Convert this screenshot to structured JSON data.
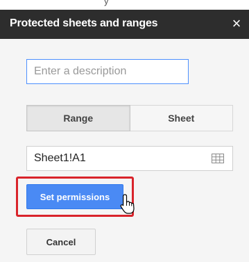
{
  "top_clip_text": "y",
  "panel": {
    "title": "Protected sheets and ranges",
    "close_glyph": "×",
    "description": {
      "value": "",
      "placeholder": "Enter a description"
    },
    "toggle": {
      "range_label": "Range",
      "sheet_label": "Sheet",
      "selected": "Range"
    },
    "range_field": {
      "value": "Sheet1!A1",
      "icon": "grid-icon"
    },
    "set_permissions_label": "Set permissions",
    "cancel_label": "Cancel"
  },
  "colors": {
    "header_bg": "#2d2d2d",
    "primary_button": "#4a8af4",
    "highlight": "#d9242b",
    "focus_border": "#4d90fe"
  }
}
